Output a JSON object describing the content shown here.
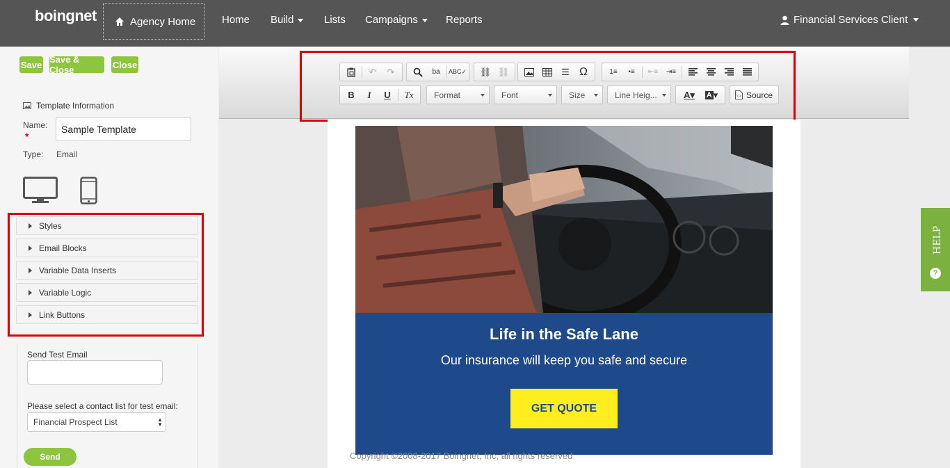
{
  "topnav": {
    "logo": "boingnet",
    "agency_home": "Agency Home",
    "items": [
      {
        "label": "Home"
      },
      {
        "label": "Build"
      },
      {
        "label": "Lists"
      },
      {
        "label": "Campaigns"
      },
      {
        "label": "Reports"
      }
    ],
    "user": "Financial Services Client"
  },
  "sidebar": {
    "buttons": {
      "save": "Save",
      "save_close": "Save & Close",
      "close": "Close"
    },
    "template_info_title": "Template Information",
    "name_label": "Name:",
    "name_value": "Sample Template",
    "type_label": "Type:",
    "type_value": "Email",
    "accordion": [
      {
        "label": "Styles"
      },
      {
        "label": "Email Blocks"
      },
      {
        "label": "Variable Data Inserts"
      },
      {
        "label": "Variable Logic"
      },
      {
        "label": "Link Buttons"
      }
    ],
    "send_test_label": "Send Test Email",
    "contact_list_label": "Please select a contact list for test email:",
    "contact_list_value": "Financial Prospect List",
    "send_button": "Send"
  },
  "toolbar": {
    "format": "Format",
    "font": "Font",
    "size": "Size",
    "line_height": "Line Heig...",
    "source": "Source"
  },
  "email": {
    "title": "Life in the Safe Lane",
    "subtitle": "Our insurance will keep you safe and secure",
    "cta": "GET QUOTE",
    "copyright": "Copyright ©2008-2017 Boingnet, Inc, all rights reserved"
  },
  "help_tab": "HELP",
  "colors": {
    "nav_bg": "#555555",
    "accent_green": "#8cc63f",
    "email_blue": "#1e4a8c",
    "cta_yellow": "#ffee1f",
    "highlight_red": "#e00000"
  }
}
